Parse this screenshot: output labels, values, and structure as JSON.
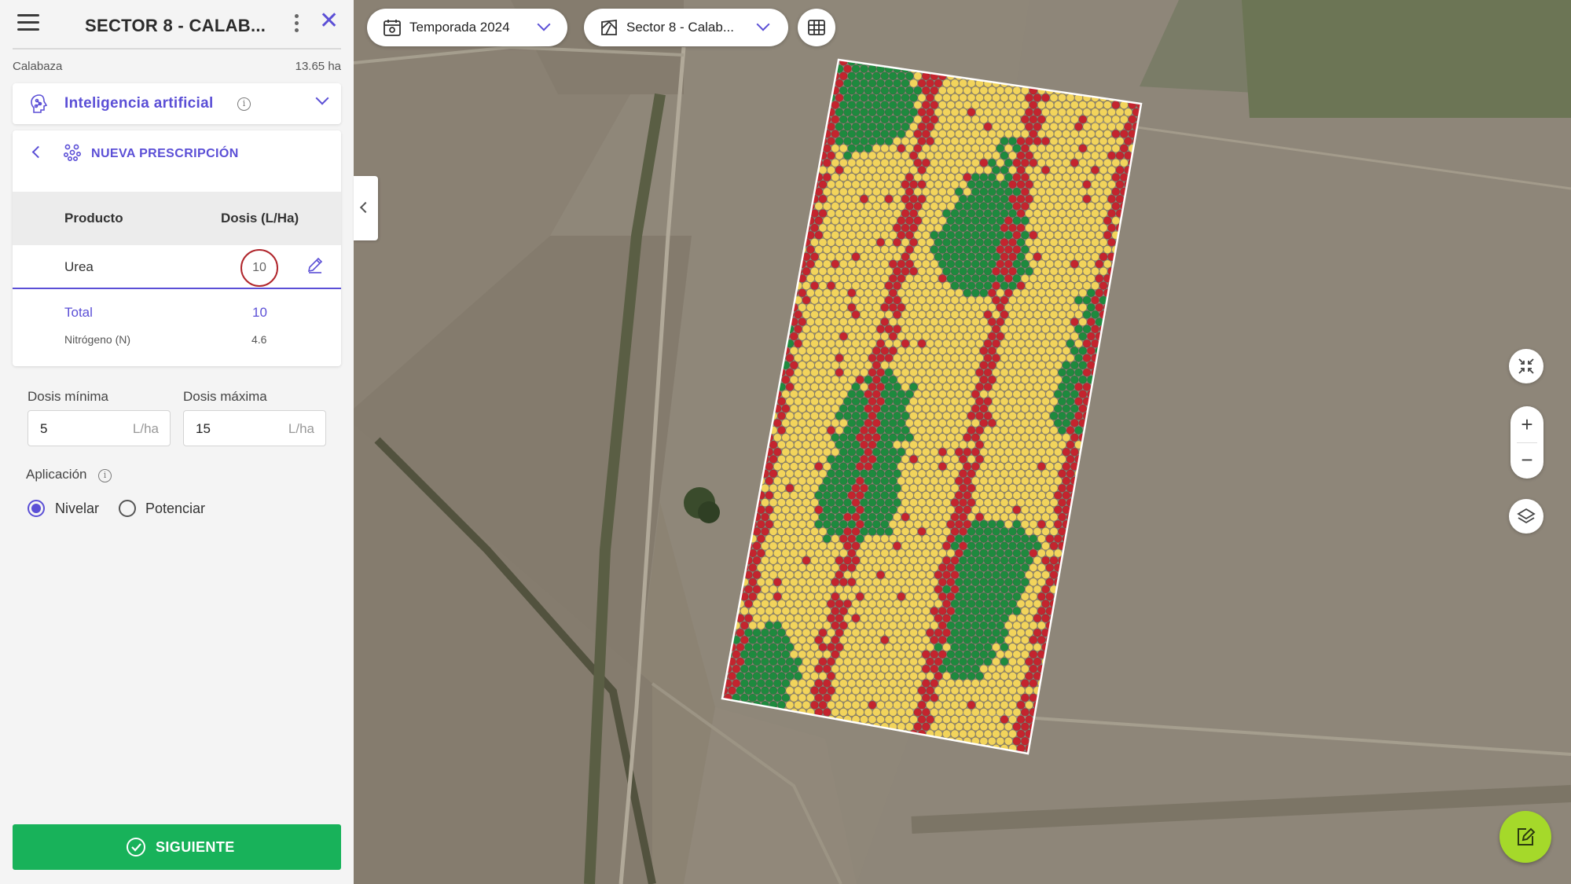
{
  "header": {
    "title": "SECTOR 8 - CALAB..."
  },
  "field": {
    "crop": "Calabaza",
    "area": "13.65 ha"
  },
  "ai_section": {
    "label": "Inteligencia artificial"
  },
  "prescription": {
    "title": "NUEVA PRESCRIPCIÓN",
    "columns": {
      "product": "Producto",
      "dose": "Dosis (L/Ha)"
    },
    "rows": [
      {
        "product": "Urea",
        "dose": "10"
      }
    ],
    "total": {
      "label": "Total",
      "value": "10"
    },
    "nitrogen": {
      "label": "Nitrógeno (N)",
      "value": "4.6"
    }
  },
  "dose_limits": {
    "min_label": "Dosis mínima",
    "min_value": "5",
    "min_unit": "L/ha",
    "max_label": "Dosis máxima",
    "max_value": "15",
    "max_unit": "L/ha"
  },
  "application": {
    "label": "Aplicación",
    "options": [
      {
        "label": "Nivelar",
        "selected": true
      },
      {
        "label": "Potenciar",
        "selected": false
      }
    ]
  },
  "next_button": {
    "label": "SIGUIENTE"
  },
  "map": {
    "season_selector": "Temporada 2024",
    "sector_selector": "Sector 8 - Calab...",
    "zoom_in": "+",
    "zoom_out": "−",
    "zone_colors": {
      "high": "#1e8a3e",
      "medium": "#f2d45c",
      "low": "#c4242e"
    }
  },
  "colors": {
    "accent": "#5b4fd6",
    "primary_button": "#18b25a",
    "fab": "#a5d92a"
  }
}
